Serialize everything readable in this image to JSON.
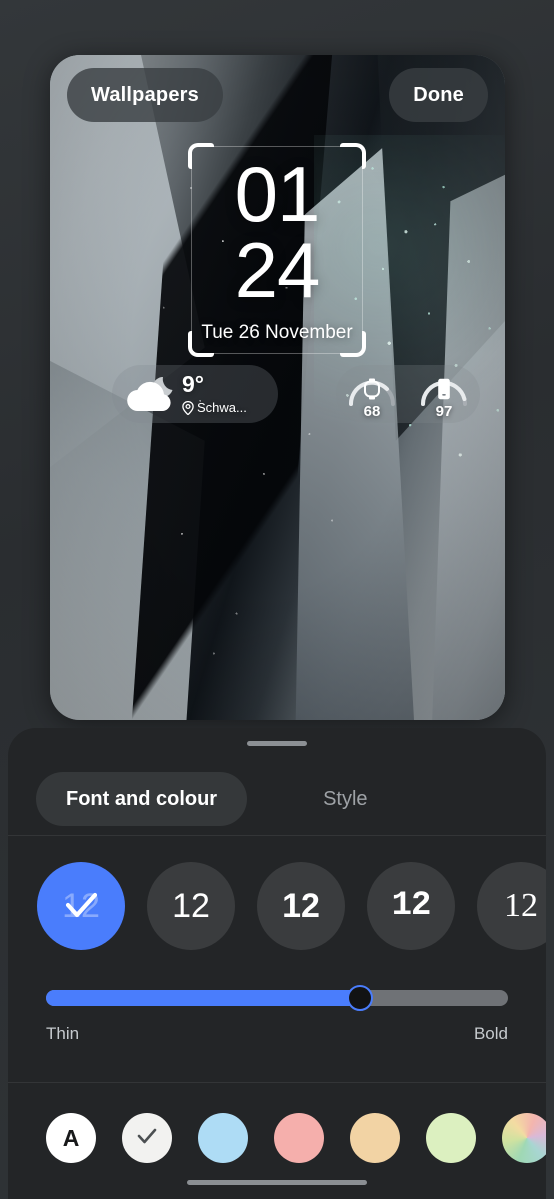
{
  "screen": {
    "background_color": "#2b2e31",
    "accent_color": "#4a7dfc"
  },
  "preview": {
    "wallpaper_description": "abstract metallic crystalline facets in silver and black with teal glitter",
    "top_buttons": {
      "wallpapers_label": "Wallpapers",
      "done_label": "Done"
    },
    "clock_widget": {
      "hours": "01",
      "minutes": "24",
      "date": "Tue 26 November",
      "selected": true
    },
    "weather_widget": {
      "icon": "cloud-moon-icon",
      "temperature": "9°",
      "location_icon": "location-pin-icon",
      "location": "Schwa..."
    },
    "battery_widget": {
      "items": [
        {
          "icon": "watch-icon",
          "value": "68"
        },
        {
          "icon": "phone-icon",
          "value": "97"
        }
      ]
    }
  },
  "sheet": {
    "grabber": "sheet-grabber",
    "tabs": [
      {
        "label": "Font and colour",
        "active": true
      },
      {
        "label": "Style",
        "active": false
      }
    ],
    "font_options": [
      {
        "sample": "12",
        "style": "sans",
        "selected": true,
        "check_icon": "check-icon"
      },
      {
        "sample": "12",
        "style": "sans",
        "selected": false
      },
      {
        "sample": "12",
        "style": "bold",
        "selected": false
      },
      {
        "sample": "12",
        "style": "mono",
        "selected": false
      },
      {
        "sample": "12",
        "style": "serif",
        "selected": false
      }
    ],
    "weight_slider": {
      "value_percent": 68,
      "min_label": "Thin",
      "max_label": "Bold",
      "fill_color": "#4a7dfc",
      "track_color": "#6f7276"
    },
    "colour_swatches": [
      {
        "name": "auto",
        "label": "A",
        "color": "#ffffff",
        "selected": false
      },
      {
        "name": "white",
        "label": "",
        "color": "#f2f2f0",
        "selected": true,
        "check_icon": "check-icon"
      },
      {
        "name": "light-blue",
        "label": "",
        "color": "#aedcf5",
        "selected": false
      },
      {
        "name": "salmon",
        "label": "",
        "color": "#f5afac",
        "selected": false
      },
      {
        "name": "peach",
        "label": "",
        "color": "#f2d3a4",
        "selected": false
      },
      {
        "name": "light-green",
        "label": "",
        "color": "#dcf0c0",
        "selected": false
      },
      {
        "name": "gradient",
        "label": "",
        "color": "#c9dfa8",
        "selected": false
      }
    ]
  },
  "system": {
    "home_indicator": "home-gesture-bar"
  }
}
